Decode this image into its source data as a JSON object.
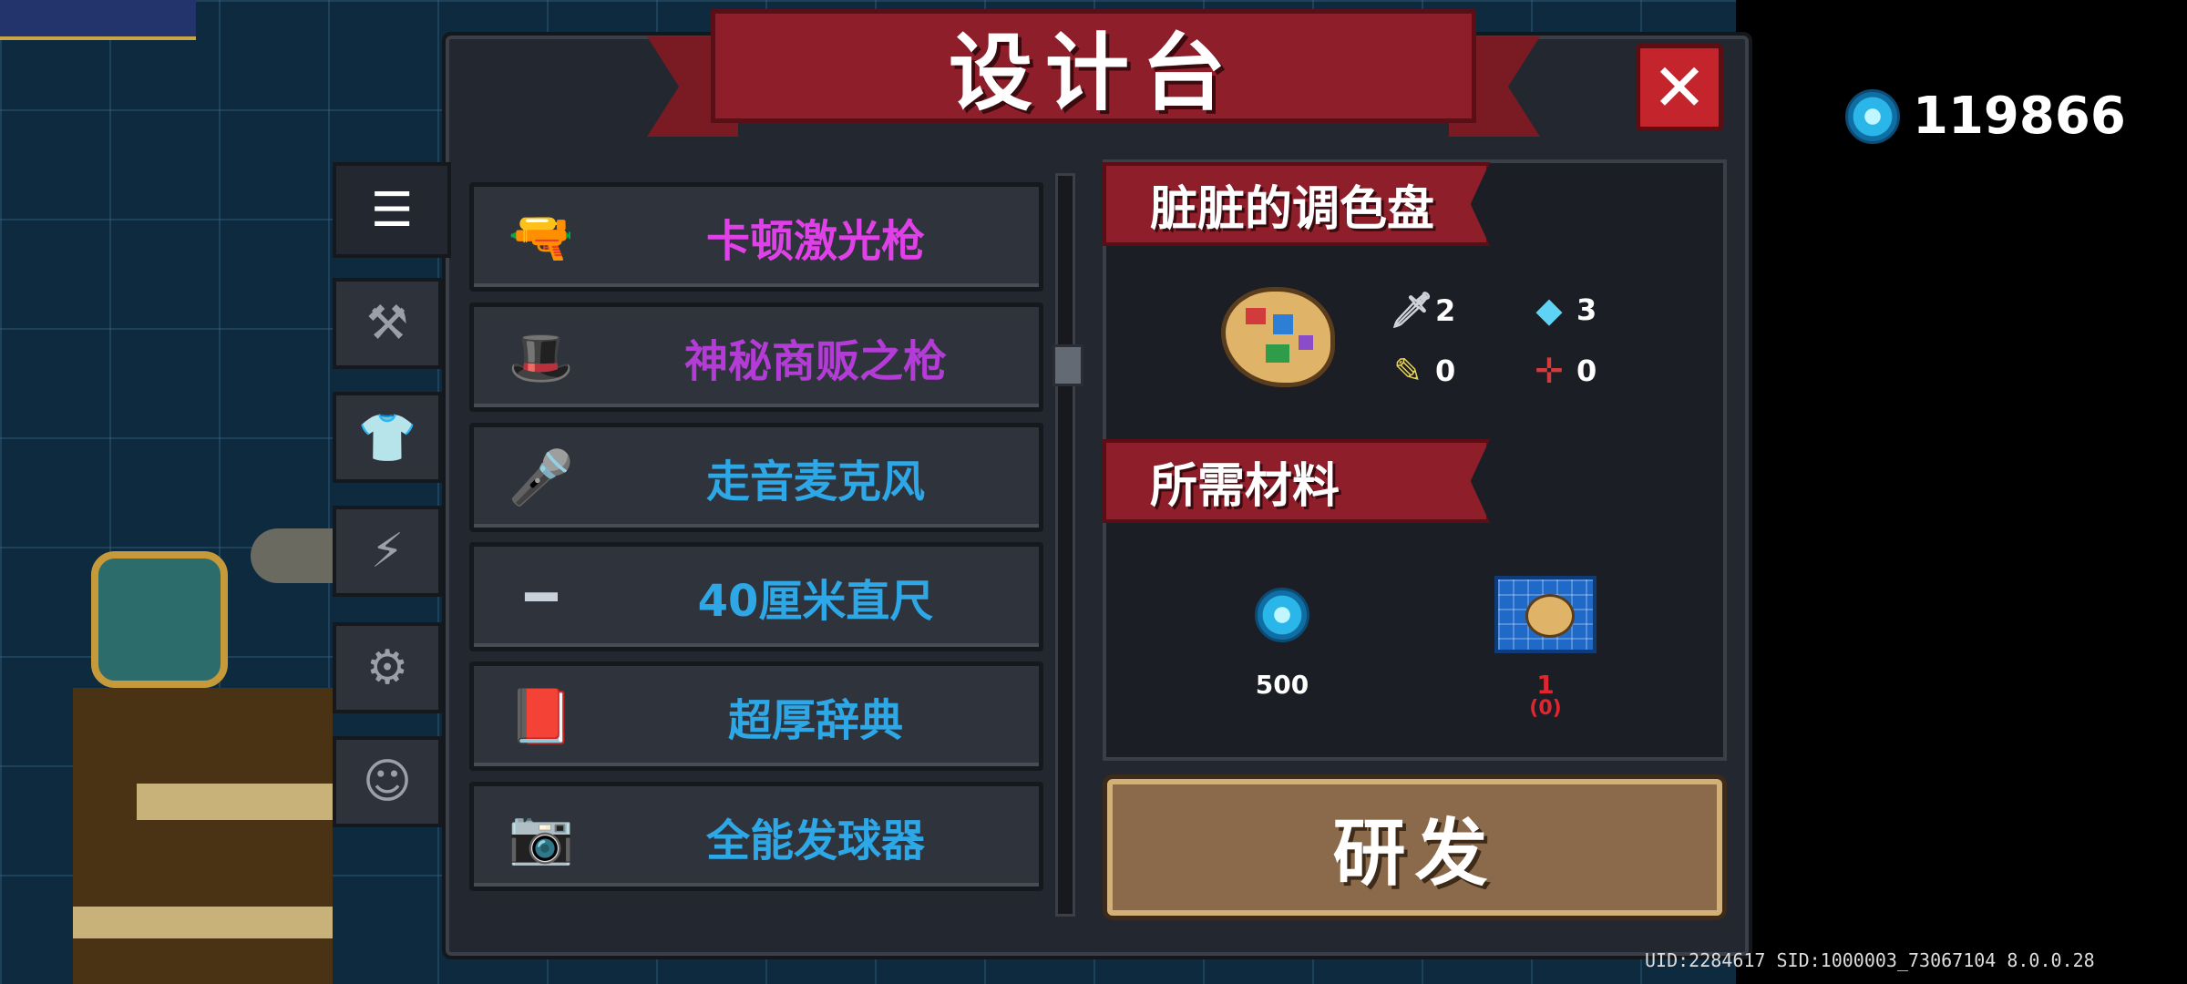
{
  "title": "设计台",
  "close_label": "✕",
  "currency": {
    "icon": "blue-gem-icon",
    "value": "119866"
  },
  "uid_text": "UID:2284617 SID:1000003_73067104 8.0.0.28",
  "side_tabs": [
    {
      "icon": "list-icon",
      "glyph": "☰",
      "active": true
    },
    {
      "icon": "weapon-icon",
      "glyph": "⚒",
      "active": false
    },
    {
      "icon": "armor-icon",
      "glyph": "👕",
      "active": false
    },
    {
      "icon": "skill-lightning-icon",
      "glyph": "⚡",
      "active": false
    },
    {
      "icon": "pet-icon",
      "glyph": "⚙",
      "active": false
    },
    {
      "icon": "character-icon",
      "glyph": "☺",
      "active": false
    }
  ],
  "items": [
    {
      "name": "卡顿激光枪",
      "color": "#e040e8",
      "icon": "laser-gun-icon",
      "glyph": "🔫"
    },
    {
      "name": "神秘商贩之枪",
      "color": "#b43cd6",
      "icon": "merchant-gun-icon",
      "glyph": "🎩"
    },
    {
      "name": "走音麦克风",
      "color": "#2ea7e6",
      "icon": "microphone-icon",
      "glyph": "🎤"
    },
    {
      "name": "40厘米直尺",
      "color": "#2ea7e6",
      "icon": "ruler-icon",
      "glyph": "━"
    },
    {
      "name": "超厚辞典",
      "color": "#2ea7e6",
      "icon": "dictionary-icon",
      "glyph": "📕"
    },
    {
      "name": "全能发球器",
      "color": "#2ea7e6",
      "icon": "ball-launcher-icon",
      "glyph": "📷"
    }
  ],
  "detail": {
    "item_name": "脏脏的调色盘",
    "item_icon": "palette-icon",
    "stats": [
      {
        "icon": "attack-icon",
        "glyph": "🗡",
        "value": "2"
      },
      {
        "icon": "energy-cost-icon",
        "glyph": "◆",
        "value": "3"
      },
      {
        "icon": "critical-icon",
        "glyph": "✎",
        "value": "0"
      },
      {
        "icon": "accuracy-icon",
        "glyph": "✛",
        "value": "0"
      }
    ],
    "materials_title": "所需材料",
    "materials": [
      {
        "icon": "blue-gem-icon",
        "amount": "500",
        "owned": ""
      },
      {
        "icon": "palette-blueprint-icon",
        "amount": "1",
        "owned": "(0)"
      }
    ],
    "research_label": "研发"
  }
}
